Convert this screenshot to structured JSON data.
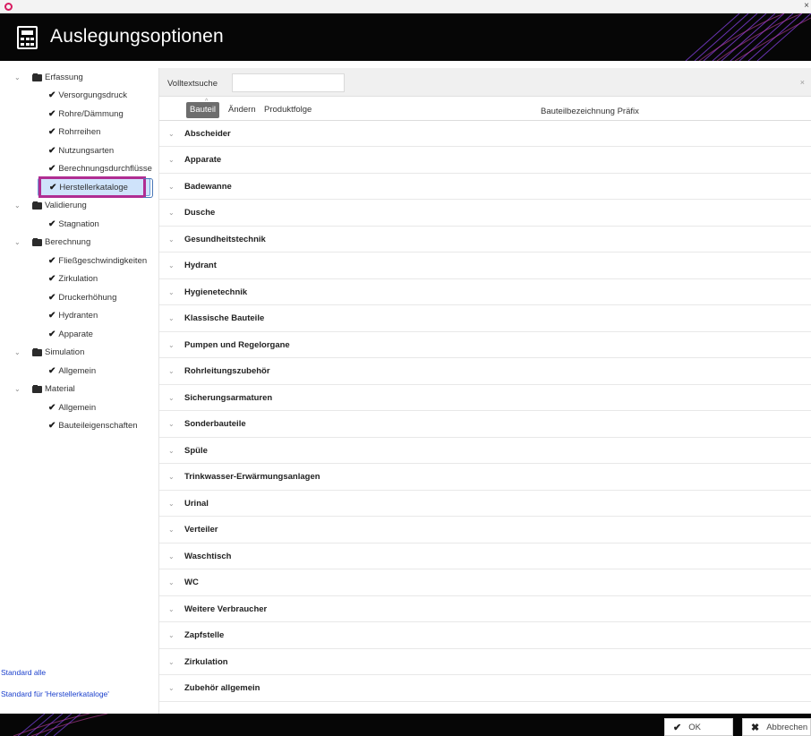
{
  "window": {
    "title": "Auslegungsoptionen",
    "icons": {
      "app": "app-logo-icon",
      "close": "close-icon",
      "header": "calculator-icon"
    }
  },
  "tree": {
    "groups": [
      {
        "label": "Erfassung",
        "items": [
          "Versorgungsdruck",
          "Rohre/Dämmung",
          "Rohrreihen",
          "Nutzungsarten",
          "Berechnungsdurchflüsse",
          "Herstellerkataloge"
        ]
      },
      {
        "label": "Validierung",
        "items": [
          "Stagnation"
        ]
      },
      {
        "label": "Berechnung",
        "items": [
          "Fließgeschwindigkeiten",
          "Zirkulation",
          "Druckerhöhung",
          "Hydranten",
          "Apparate"
        ]
      },
      {
        "label": "Simulation",
        "items": [
          "Allgemein"
        ]
      },
      {
        "label": "Material",
        "items": [
          "Allgemein",
          "Bauteileigenschaften"
        ]
      }
    ],
    "selected": "Herstellerkataloge"
  },
  "links": {
    "standard_all": "Standard alle",
    "standard_for": "Standard für 'Herstellerkataloge'"
  },
  "search": {
    "label": "Volltextsuche",
    "value": "",
    "clear_icon": "close-icon"
  },
  "columns": {
    "group_buttons": [
      "Bauteil",
      "Ändern",
      "Produktfolge"
    ],
    "active": "Bauteil",
    "prefix_header": "Bauteilbezeichnung Präfix"
  },
  "categories": [
    "Abscheider",
    "Apparate",
    "Badewanne",
    "Dusche",
    "Gesundheitstechnik",
    "Hydrant",
    "Hygienetechnik",
    "Klassische Bauteile",
    "Pumpen und Regelorgane",
    "Rohrleitungszubehör",
    "Sicherungsarmaturen",
    "Sonderbauteile",
    "Spüle",
    "Trinkwasser-Erwärmungsanlagen",
    "Urinal",
    "Verteiler",
    "Waschtisch",
    "WC",
    "Weitere Verbraucher",
    "Zapfstelle",
    "Zirkulation",
    "Zubehör allgemein"
  ],
  "footer": {
    "ok_label": "OK",
    "cancel_label": "Abbrechen"
  },
  "colors": {
    "header_bg": "#060606",
    "accent_selection": "#cfe3fb",
    "highlight_frame": "#b02d92",
    "link": "#1a3fcc"
  }
}
